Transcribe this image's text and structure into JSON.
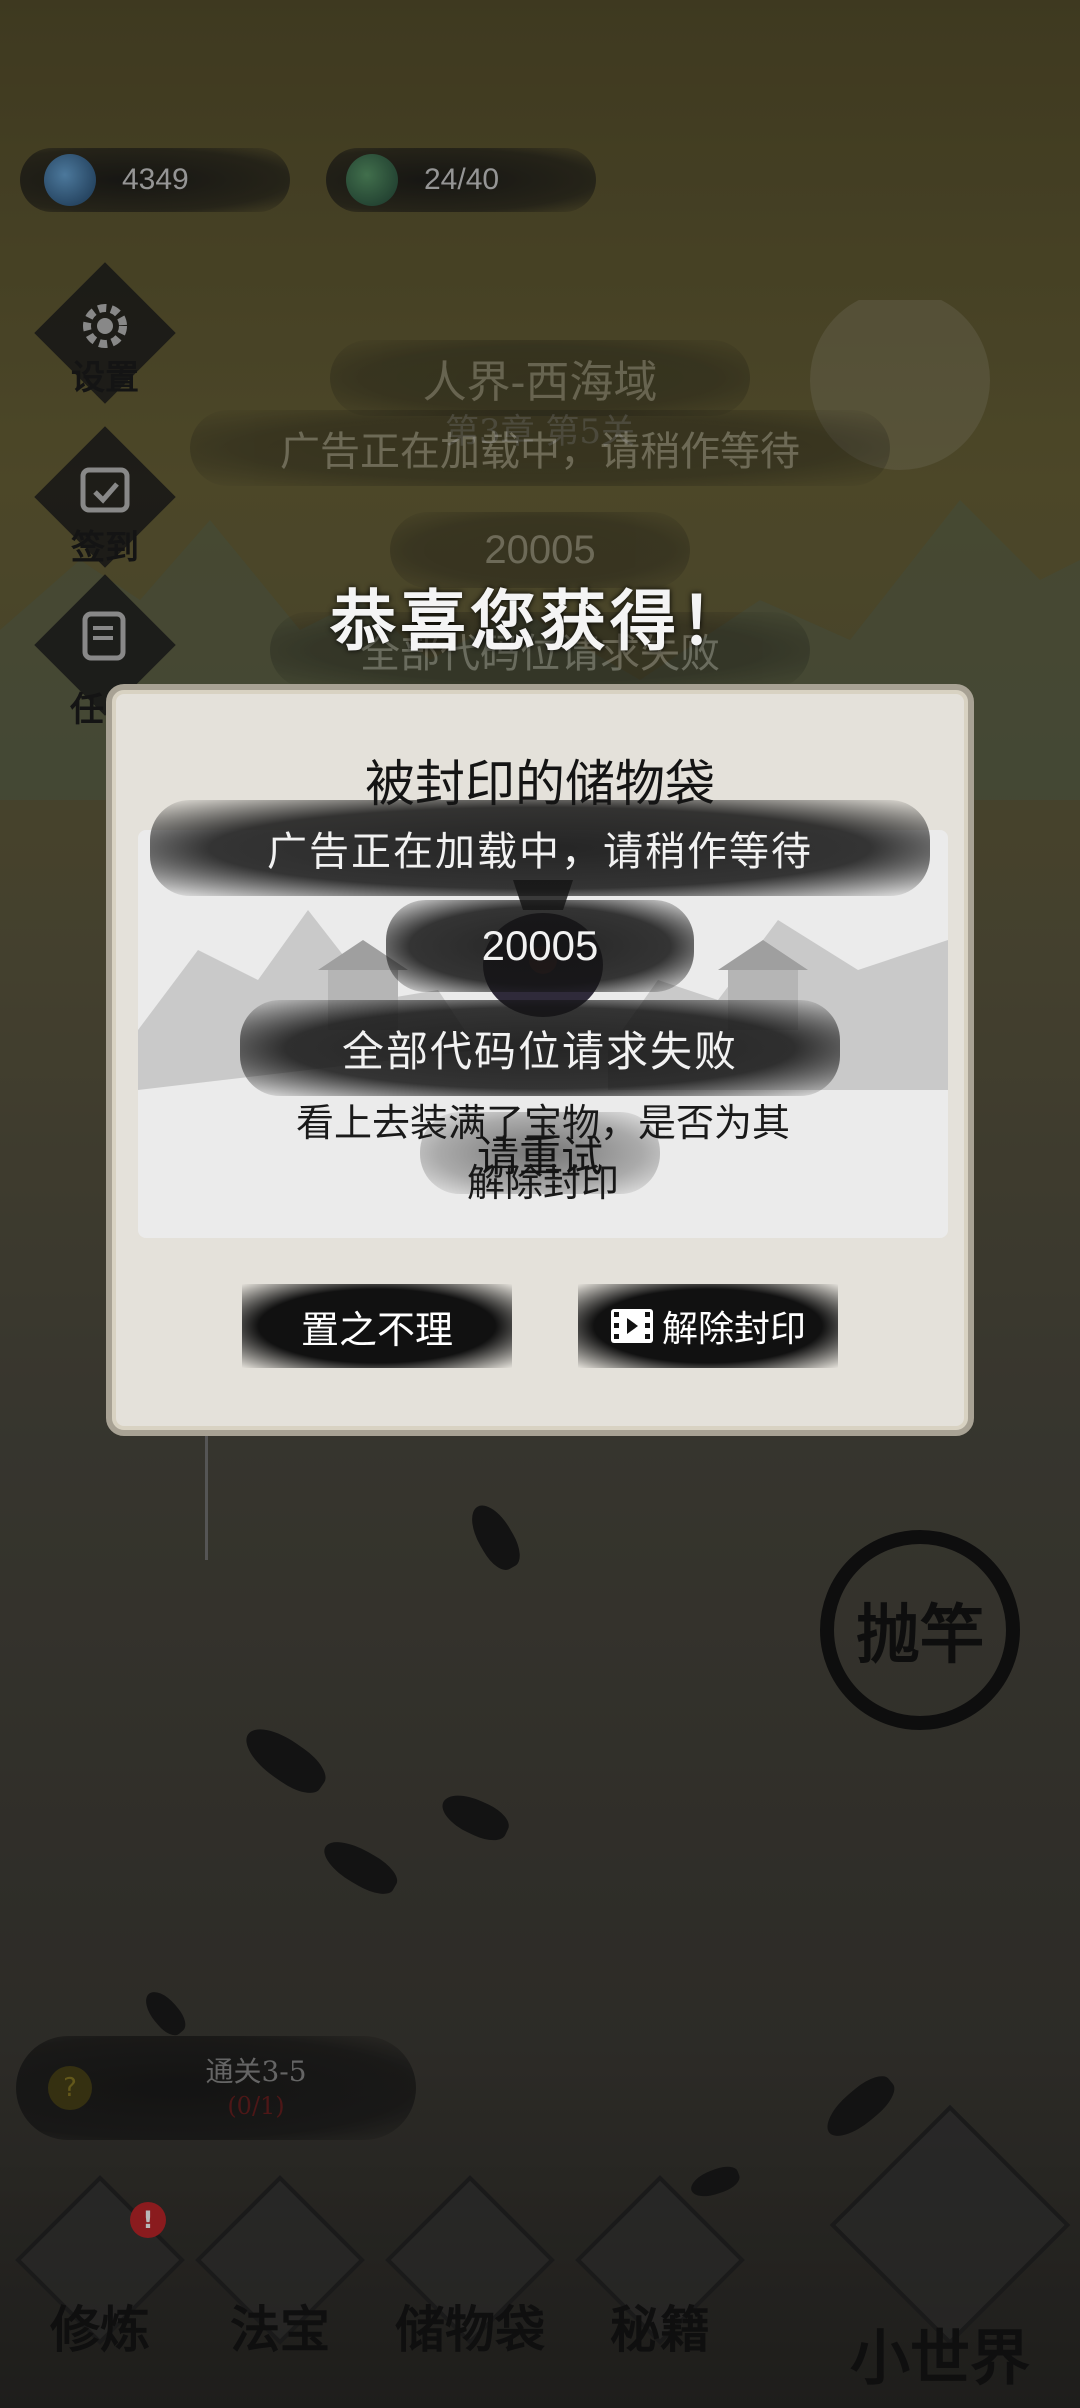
{
  "resources": {
    "spirit_stones": "4349",
    "stamina": "24/40"
  },
  "side_menu": {
    "settings_label": "设置",
    "checkin_label": "签到",
    "task_label": "任"
  },
  "level": {
    "realm_title": "人界-西海域",
    "chapter": "第3章 第5关"
  },
  "ad_toast": {
    "loading_message": "广告正在加载中，请稍作等待",
    "error_code": "20005",
    "error_message": "全部代码位请求失败",
    "retry_message": "请重试"
  },
  "reward": {
    "header_title": "恭喜您获得！",
    "item_name": "被封印的储物袋",
    "description": "看上去装满了宝物，是否为其",
    "unseal_hint": "解除封印",
    "ignore_button": "置之不理",
    "unseal_button": "解除封印"
  },
  "cast_button": "抛竿",
  "quest": {
    "title": "通关3-5",
    "progress": "(0/1)"
  },
  "bottom_nav": {
    "items": [
      {
        "label": "修炼"
      },
      {
        "label": "法宝"
      },
      {
        "label": "储物袋"
      },
      {
        "label": "秘籍"
      },
      {
        "label": "小世界"
      }
    ]
  },
  "colors": {
    "dialog_bg": "#e4e1da",
    "ink_black": "#111111",
    "badge_red": "#c0262a"
  }
}
